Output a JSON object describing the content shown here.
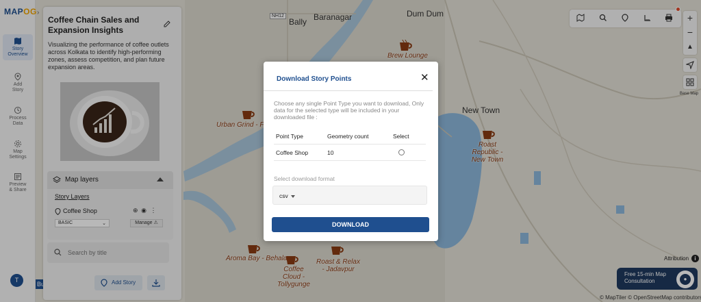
{
  "app": {
    "logo_text_a": "MAP",
    "logo_text_b": "OG"
  },
  "rail": {
    "items": [
      {
        "label_1": "Story",
        "label_2": "Overview",
        "icon": "map-icon"
      },
      {
        "label_1": "Add",
        "label_2": "Story",
        "icon": "pin-icon"
      },
      {
        "label_1": "Process",
        "label_2": "Data",
        "icon": "process-icon"
      },
      {
        "label_1": "Map",
        "label_2": "Settings",
        "icon": "gear-icon"
      },
      {
        "label_1": "Preview",
        "label_2": "& Share",
        "icon": "preview-icon"
      }
    ],
    "avatar_letter": "T"
  },
  "panel": {
    "title": "Coffee Chain Sales and Expansion Insights",
    "description": "Visualizing the performance of coffee outlets across Kolkata to identify high-performing zones, assess competition, and plan future expansion areas.",
    "map_layers_title": "Map layers",
    "story_layers_label": "Story Layers",
    "layer_name": "Coffee Shop",
    "layer_style": "BASIC",
    "manage_label": "Manage",
    "search_placeholder": "Search by title",
    "add_story_label": "Add Story"
  },
  "map": {
    "labels": {
      "bally": "Bally",
      "baranagar": "Baranagar",
      "dum_dum": "Dum Dum",
      "new_town": "New Town",
      "nh12": "NH12",
      "bu": "Bu"
    },
    "markers": [
      {
        "name": "Brew Lounge"
      },
      {
        "name": "Urban Grind - F"
      },
      {
        "name": "Roast Republic - New Town"
      },
      {
        "name": "Aroma Bay - Behala"
      },
      {
        "name": "Coffee Cloud - Tollygunge"
      },
      {
        "name": "Roast & Relax - Jadavpur"
      }
    ],
    "basemap_label": "Base Map",
    "attribution": "Attribution",
    "copyright": "© MapTiler © OpenStreetMap contributors"
  },
  "consult": {
    "line1": "Free 15-min Map",
    "line2": "Consultation"
  },
  "modal": {
    "title": "Download Story Points",
    "instructions": "Choose any single Point Type you want to download, Only data for the selected type will be included in your downloaded file :",
    "columns": [
      "Point Type",
      "Geometry count",
      "Select"
    ],
    "rows": [
      {
        "point_type": "Coffee Shop",
        "count": "10"
      }
    ],
    "format_label": "Select download format",
    "format_value": "csv",
    "download_label": "DOWNLOAD"
  },
  "colors": {
    "primary": "#1f4f8f",
    "accent": "#f0a400",
    "water": "#7fb0d6",
    "consult": "#1f3a5f"
  }
}
